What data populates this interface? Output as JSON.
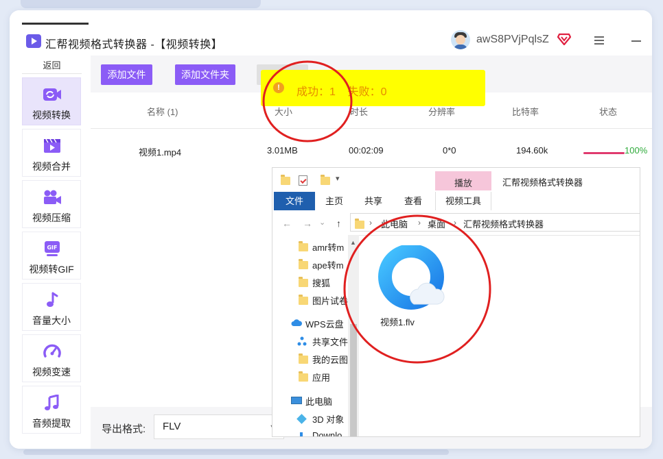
{
  "app": {
    "title": "汇帮视频格式转换器 -【视频转换】",
    "username": "awS8PVjPqlsZ"
  },
  "sidebar": {
    "back_label": "返回",
    "items": [
      {
        "label": "视频转换",
        "icon": "video-convert-icon",
        "active": true
      },
      {
        "label": "视频合并",
        "icon": "video-merge-icon"
      },
      {
        "label": "视频压缩",
        "icon": "video-compress-icon"
      },
      {
        "label": "视频转GIF",
        "icon": "gif-icon"
      },
      {
        "label": "音量大小",
        "icon": "music-note-icon"
      },
      {
        "label": "视频变速",
        "icon": "speedometer-icon"
      },
      {
        "label": "音频提取",
        "icon": "audio-extract-icon"
      }
    ]
  },
  "toolbar": {
    "add_file": "添加文件",
    "add_folder": "添加文件夹"
  },
  "table": {
    "columns": [
      "名称 (1)",
      "大小",
      "时长",
      "分辨率",
      "比特率",
      "状态"
    ],
    "rows": [
      {
        "name": "视频1.mp4",
        "size": "3.01MB",
        "duration": "00:02:09",
        "resolution": "0*0",
        "bitrate": "194.60k",
        "status": "100%",
        "progress": 1.0
      }
    ]
  },
  "toast": {
    "text": "成功：1    失败：0"
  },
  "footer": {
    "format_label": "导出格式:",
    "format_value": "FLV"
  },
  "explorer": {
    "ribbon_highlight": "播放",
    "window_title": "汇帮视频格式转换器",
    "tabs": [
      "文件",
      "主页",
      "共享",
      "查看",
      "视频工具"
    ],
    "breadcrumb": [
      "此电脑",
      "桌面",
      "汇帮视频格式转换器"
    ],
    "tree": [
      "amr转m",
      "ape转m",
      "搜狐",
      "图片试卷",
      "WPS云盘",
      "共享文件",
      "我的云图",
      "应用",
      "此电脑",
      "3D 对象",
      "Downlo"
    ],
    "file_name": "视频1.flv"
  },
  "colors": {
    "accent": "#8b5cf6",
    "active_nav": "#e9e4fb",
    "toast_bg": "#ffff00",
    "progress": "#e03a6e",
    "status_ok": "#2eaa3a",
    "annotation": "#e02020"
  }
}
